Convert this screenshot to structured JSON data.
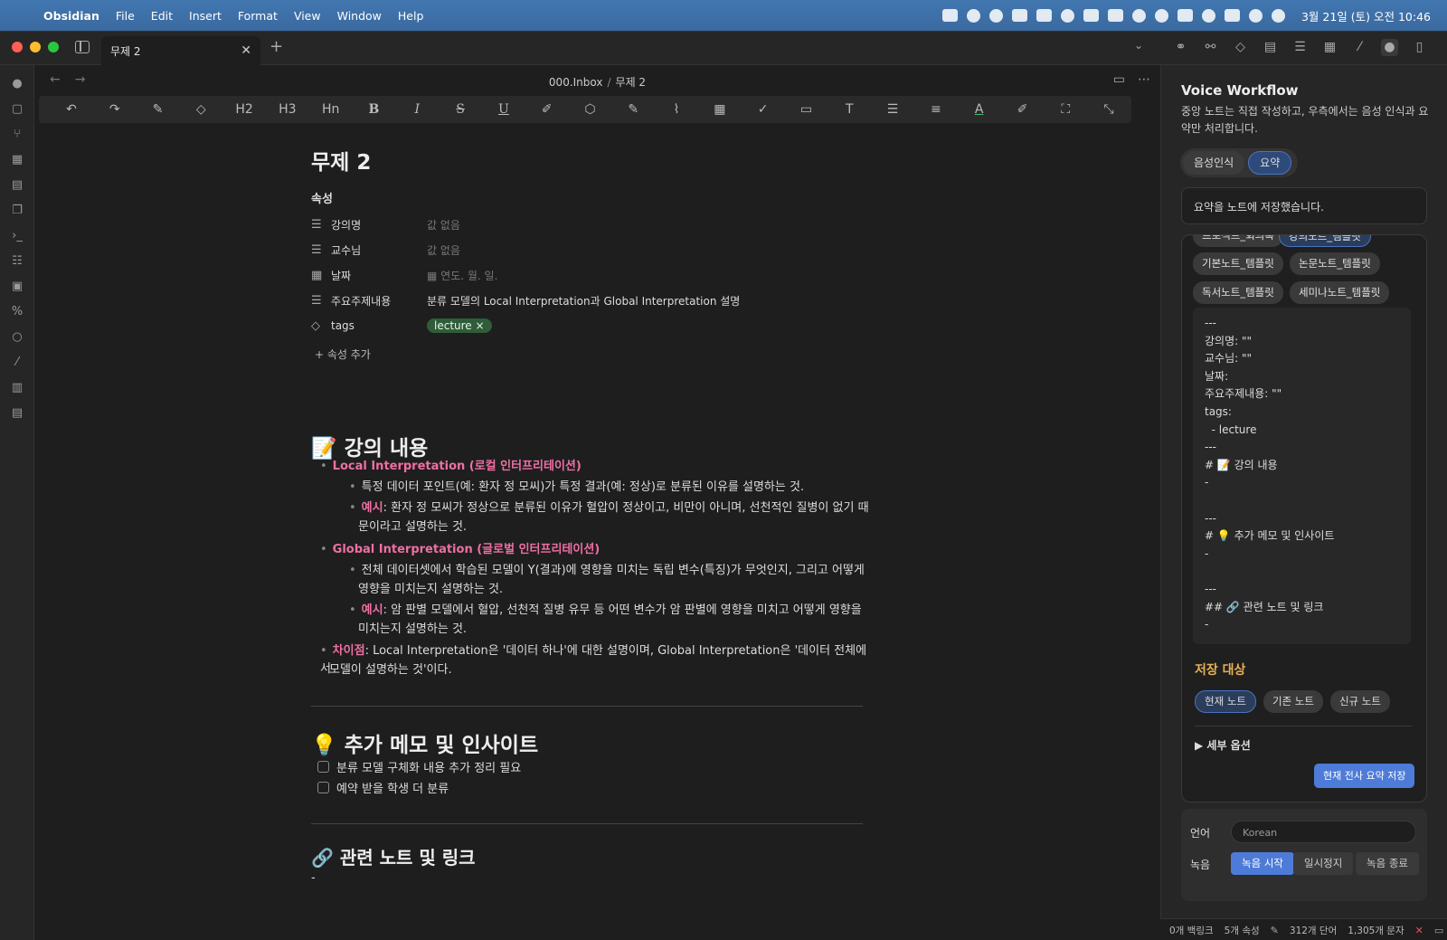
{
  "menubar": {
    "app": "Obsidian",
    "items": [
      "File",
      "Edit",
      "Insert",
      "Format",
      "View",
      "Window",
      "Help"
    ],
    "clock": "3월 21일 (토) 오전 10:46"
  },
  "tabs": [
    {
      "label": "무제 2"
    }
  ],
  "breadcrumb": {
    "folder": "000.Inbox",
    "note": "무제 2"
  },
  "toolbar": {
    "h2": "H2",
    "h3": "H3",
    "hn": "Hn",
    "bold": "B",
    "italic": "I",
    "strike": "S",
    "underline": "U"
  },
  "note": {
    "title": "무제 2",
    "properties_label": "속성",
    "properties": [
      {
        "key": "강의명",
        "value": "값 없음",
        "empty": true,
        "icon": "list-icon"
      },
      {
        "key": "교수님",
        "value": "값 없음",
        "empty": true,
        "icon": "list-icon"
      },
      {
        "key": "날짜",
        "value": "연도. 월. 일.",
        "empty": true,
        "icon": "calendar-icon"
      },
      {
        "key": "주요주제내용",
        "value": "분류 모델의 Local Interpretation과 Global Interpretation 설명",
        "empty": false,
        "icon": "list-icon"
      },
      {
        "key": "tags",
        "value": "lecture ×",
        "empty": false,
        "icon": "tags-icon"
      }
    ],
    "add_property": "+ 속성 추가",
    "section1": {
      "heading": "📝 강의 내용",
      "local_title": "Local Interpretation (로컬 인터프리테이션)",
      "local_desc": "특정 데이터 포인트(예: 환자 정 모씨)가 특정 결과(예: 정상)로 분류된 이유를 설명하는 것.",
      "local_ex_label": "예시",
      "local_ex_line1": ": 환자 정 모씨가 정상으로 분류된 이유가 혈압이 정상이고, 비만이 아니며, 선천적인 질병이 없기 때",
      "local_ex_line2": "문이라고 설명하는 것.",
      "global_title": "Global Interpretation (글로벌 인터프리테이션)",
      "global_desc_line1": "전체 데이터셋에서 학습된 모델이 Y(결과)에 영향을 미치는 독립 변수(특징)가 무엇인지, 그리고 어떻게",
      "global_desc_line2": "영향을 미치는지 설명하는 것.",
      "global_ex_label": "예시",
      "global_ex_line1": ": 암 판별 모델에서 혈압, 선천적 질병 유무 등 어떤 변수가 암 판별에 영향을 미치고 어떻게 영향을",
      "global_ex_line2": "미치는지 설명하는 것.",
      "diff_label": "차이점",
      "diff_line1": ": Local Interpretation은 '데이터 하나'에 대한 설명이며, Global Interpretation은 '데이터 전체에서",
      "diff_line2": "모델이 설명하는 것'이다."
    },
    "section2": {
      "heading": "💡 추가 메모 및 인사이트",
      "todos": [
        "분류 모델 구체화 내용 추가 정리 필요",
        "예약 받을 학생 더 분류"
      ]
    },
    "section3": {
      "heading": "🔗 관련 노트 및 링크",
      "bullet": "-"
    }
  },
  "panel": {
    "title": "Voice Workflow",
    "description": "중앙 노트는 직접 작성하고, 우측에서는 음성 인식과 요약만 처리합니다.",
    "modes": [
      {
        "label": "음성인식",
        "selected": false
      },
      {
        "label": "요약",
        "selected": true
      }
    ],
    "status": "요약을 노트에 저장했습니다.",
    "templates_cut": [
      "프로젝트_회의록",
      "강의노트_템플릿"
    ],
    "templates": [
      "기본노트_템플릿",
      "논문노트_템플릿",
      "독서노트_템플릿",
      "세미나노트_템플릿"
    ],
    "code": "---\n강의명: \"\"\n교수님: \"\"\n날짜:\n주요주제내용: \"\"\ntags:\n  - lecture\n---\n# 📝 강의 내용\n-\n\n---\n# 💡 추가 메모 및 인사이트\n-\n\n---\n## 🔗 관련 노트 및 링크\n-",
    "save_target_title": "저장 대상",
    "save_targets": [
      {
        "label": "현재 노트",
        "selected": true
      },
      {
        "label": "기존 노트",
        "selected": false
      },
      {
        "label": "신규 노트",
        "selected": false
      }
    ],
    "details": "▶ 세부 옵션",
    "save_button": "현재 전사 요약 저장",
    "language_label": "언어",
    "language_value": "Korean",
    "record_label": "녹음",
    "record_buttons": [
      "녹음 시작",
      "일시정지",
      "녹음 종료"
    ]
  },
  "statusbar": {
    "backlinks": "0개 백링크",
    "props": "5개 속성",
    "words": "312개 단어",
    "chars": "1,305개 문자"
  },
  "colors": {
    "accent": "#4e7bd8",
    "pink": "#ee6fa4",
    "save_title": "#e7b052",
    "tag": "#2f5d3a"
  }
}
